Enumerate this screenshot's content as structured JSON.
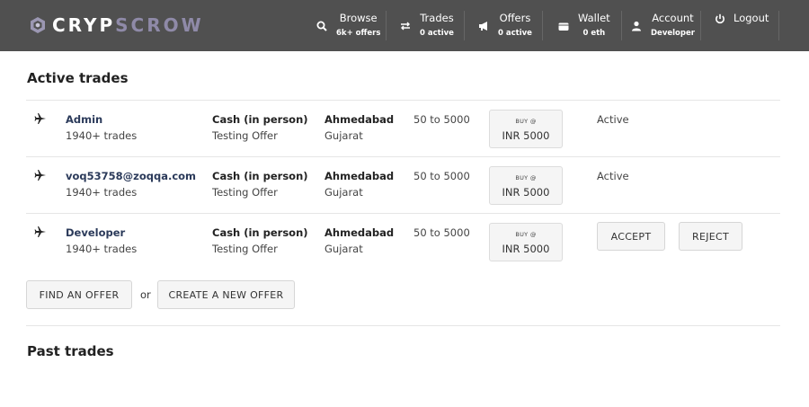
{
  "header": {
    "logo_part1": "CRYP",
    "logo_part2": "SCROW",
    "nav": [
      {
        "label": "Browse",
        "sub": "6k+ offers",
        "icon": "search-icon"
      },
      {
        "label": "Trades",
        "sub": "0 active",
        "icon": "swap-arrows-icon"
      },
      {
        "label": "Offers",
        "sub": "0 active",
        "icon": "megaphone-icon"
      },
      {
        "label": "Wallet",
        "sub": "0 eth",
        "icon": "wallet-icon"
      },
      {
        "label": "Account",
        "sub": "Developer",
        "icon": "user-icon"
      },
      {
        "label": "Logout",
        "sub": "",
        "icon": "power-icon"
      }
    ]
  },
  "active_trades": {
    "title": "Active trades",
    "rows": [
      {
        "user": "Admin",
        "user_trades": "1940+ trades",
        "method": "Cash (in person)",
        "offer": "Testing Offer",
        "city": "Ahmedabad",
        "state": "Gujarat",
        "limits": "50 to 5000",
        "price_label": "BUY @",
        "price": "INR 5000",
        "status": "Active"
      },
      {
        "user": "voq53758@zoqqa.com",
        "user_trades": "1940+ trades",
        "method": "Cash (in person)",
        "offer": "Testing Offer",
        "city": "Ahmedabad",
        "state": "Gujarat",
        "limits": "50 to 5000",
        "price_label": "BUY @",
        "price": "INR 5000",
        "status": "Active"
      },
      {
        "user": "Developer",
        "user_trades": "1940+ trades",
        "method": "Cash (in person)",
        "offer": "Testing Offer",
        "city": "Ahmedabad",
        "state": "Gujarat",
        "limits": "50 to 5000",
        "price_label": "BUY @",
        "price": "INR 5000",
        "accept_label": "ACCEPT",
        "reject_label": "REJECT"
      }
    ],
    "find_offer_label": "FIND AN OFFER",
    "or_label": "or",
    "create_offer_label": "CREATE A NEW OFFER"
  },
  "past_trades": {
    "title": "Past trades"
  },
  "colors": {
    "header_bg": "#505050",
    "logo_accent": "#8f8aa8",
    "username": "#2b3a5a"
  }
}
